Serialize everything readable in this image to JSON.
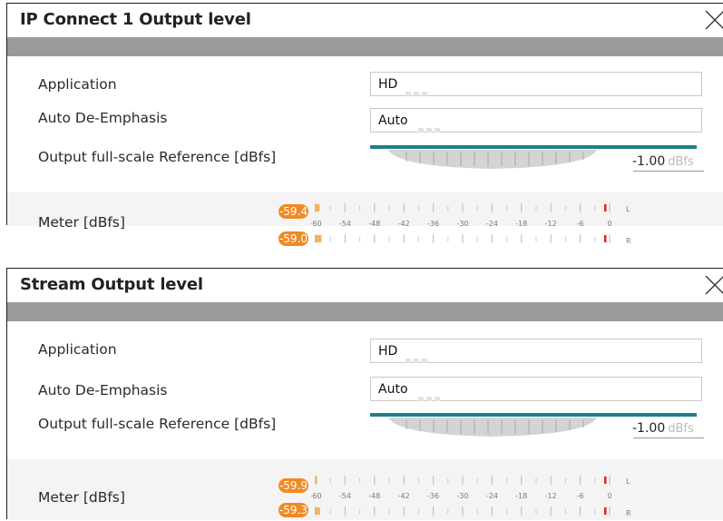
{
  "panels": [
    {
      "title": "IP Connect 1 Output level",
      "application": {
        "label": "Application",
        "value": "HD"
      },
      "de_emphasis": {
        "label": "Auto De-Emphasis",
        "value": "Auto"
      },
      "reference": {
        "label": "Output full-scale Reference [dBfs]",
        "value": "-1.00",
        "unit": "dBfs",
        "level": 0.97
      },
      "meter": {
        "label": "Meter [dBfs]",
        "left_value": "-59.4",
        "right_value": "-59.0",
        "left_level": -59.4,
        "right_level": -59.0,
        "channel_left": "L",
        "channel_right": "R"
      }
    },
    {
      "title": "Stream Output level",
      "application": {
        "label": "Application",
        "value": "HD"
      },
      "de_emphasis": {
        "label": "Auto De-Emphasis",
        "value": "Auto"
      },
      "reference": {
        "label": "Output full-scale Reference [dBfs]",
        "value": "-1.00",
        "unit": "dBfs",
        "level": 0.97
      },
      "meter": {
        "label": "Meter [dBfs]",
        "left_value": "-59.9",
        "right_value": "-59.3",
        "left_level": -59.9,
        "right_level": -59.3,
        "channel_left": "L",
        "channel_right": "R"
      }
    }
  ],
  "meter_scale": [
    "-60",
    "-54",
    "-48",
    "-42",
    "-36",
    "-30",
    "-24",
    "-18",
    "-12",
    "-6",
    "0"
  ],
  "colors": {
    "accent": "#1e7f8c",
    "badge": "#f08a24",
    "peak": "#e02020",
    "header_bar": "#9a9a9a"
  }
}
